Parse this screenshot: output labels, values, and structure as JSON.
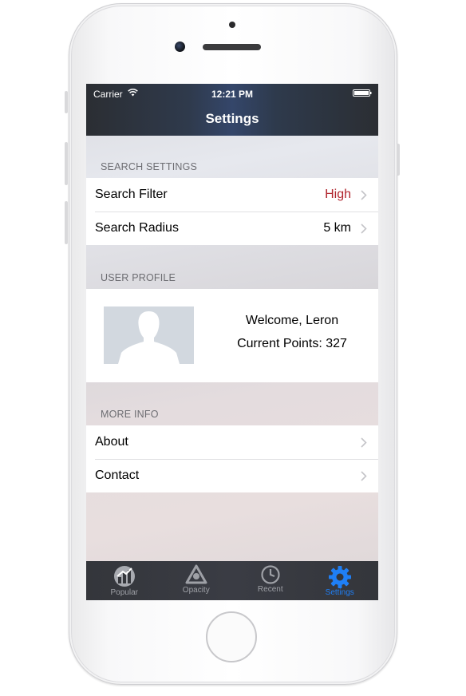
{
  "status_bar": {
    "carrier": "Carrier",
    "time": "12:21 PM"
  },
  "nav": {
    "title": "Settings"
  },
  "search_settings": {
    "header": "SEARCH SETTINGS",
    "rows": [
      {
        "label": "Search Filter",
        "value": "High"
      },
      {
        "label": "Search Radius",
        "value": "5 km"
      }
    ]
  },
  "user_profile": {
    "header": "USER PROFILE",
    "welcome": "Welcome, Leron",
    "points": "Current Points: 327"
  },
  "more_info": {
    "header": "MORE INFO",
    "rows": [
      {
        "label": "About"
      },
      {
        "label": "Contact"
      }
    ]
  },
  "tab_bar": {
    "tabs": [
      {
        "label": "Popular",
        "icon": "popular-chart-icon"
      },
      {
        "label": "Opacity",
        "icon": "opacity-triangle-icon"
      },
      {
        "label": "Recent",
        "icon": "clock-icon"
      },
      {
        "label": "Settings",
        "icon": "gear-icon"
      }
    ],
    "active_index": 3
  },
  "colors": {
    "accent_red": "#b0232b",
    "tab_active": "#1f7ff5"
  }
}
